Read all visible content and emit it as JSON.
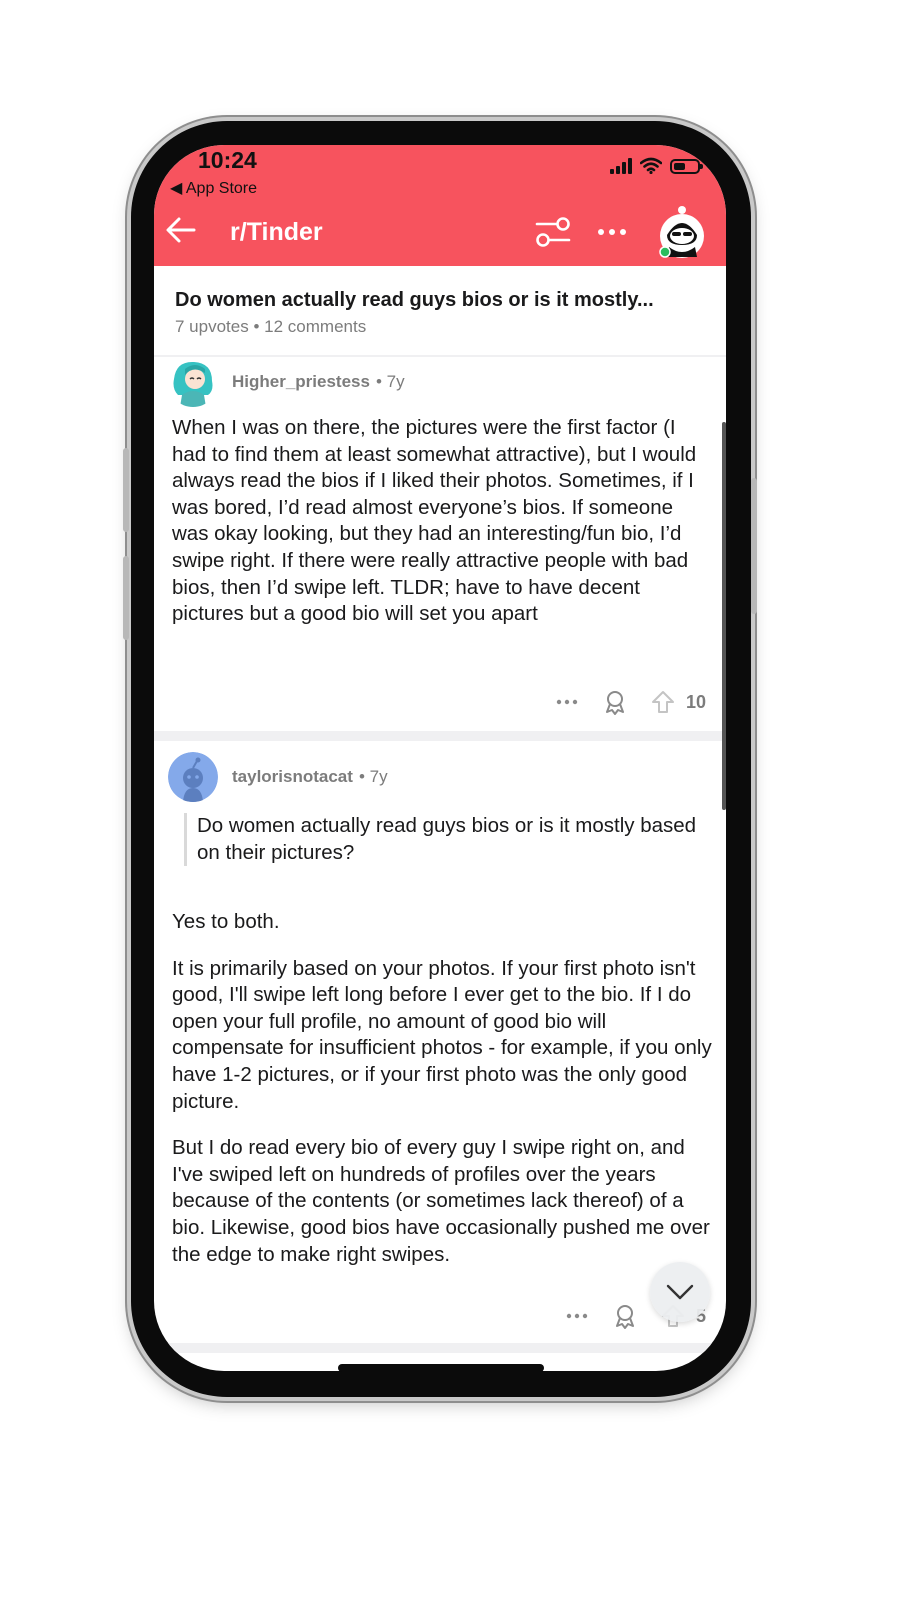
{
  "status_bar": {
    "time": "10:24",
    "back_app": "◀ App Store"
  },
  "header": {
    "subreddit": "r/Tinder",
    "accent_color": "#f7535e",
    "icons": [
      "back-arrow-icon",
      "filter-icon",
      "more-icon",
      "user-avatar-icon"
    ]
  },
  "post": {
    "title": "Do women actually read guys bios or is it mostly...",
    "upvotes": "7 upvotes",
    "separator": "•",
    "comments": "12 comments"
  },
  "comments": [
    {
      "author": "Higher_priestess",
      "age": "• 7y",
      "body": "When I was on there, the pictures were the first factor (I had to find them at least somewhat attractive), but I would always read the bios if I liked their photos. Sometimes, if I was bored, I’d read almost everyone’s bios. If someone was okay looking, but they had an interesting/fun bio, I’d swipe right. If there were really attractive people with bad bios, then I’d swipe left. TLDR; have to have decent pictures but a good bio will set you apart",
      "votes": "10"
    },
    {
      "author": "taylorisnotacat",
      "age": "• 7y",
      "quote": "Do women actually read guys bios or is it mostly based on their pictures?",
      "paragraphs": [
        "Yes to both.",
        "It is primarily based on your photos. If your first photo isn't good, I'll swipe left long before I ever get to the bio. If I do open your full profile, no amount of good bio will compensate for insufficient photos - for example, if you only have 1-2 pictures, or if your first photo was the only good picture.",
        "But I do read every bio of every guy I swipe right on, and I've swiped left on hundreds of profiles over the years because of the contents (or sometimes lack thereof) of a bio. Likewise, good bios have occasionally pushed me over the edge to make right swipes."
      ],
      "votes": "5"
    }
  ]
}
